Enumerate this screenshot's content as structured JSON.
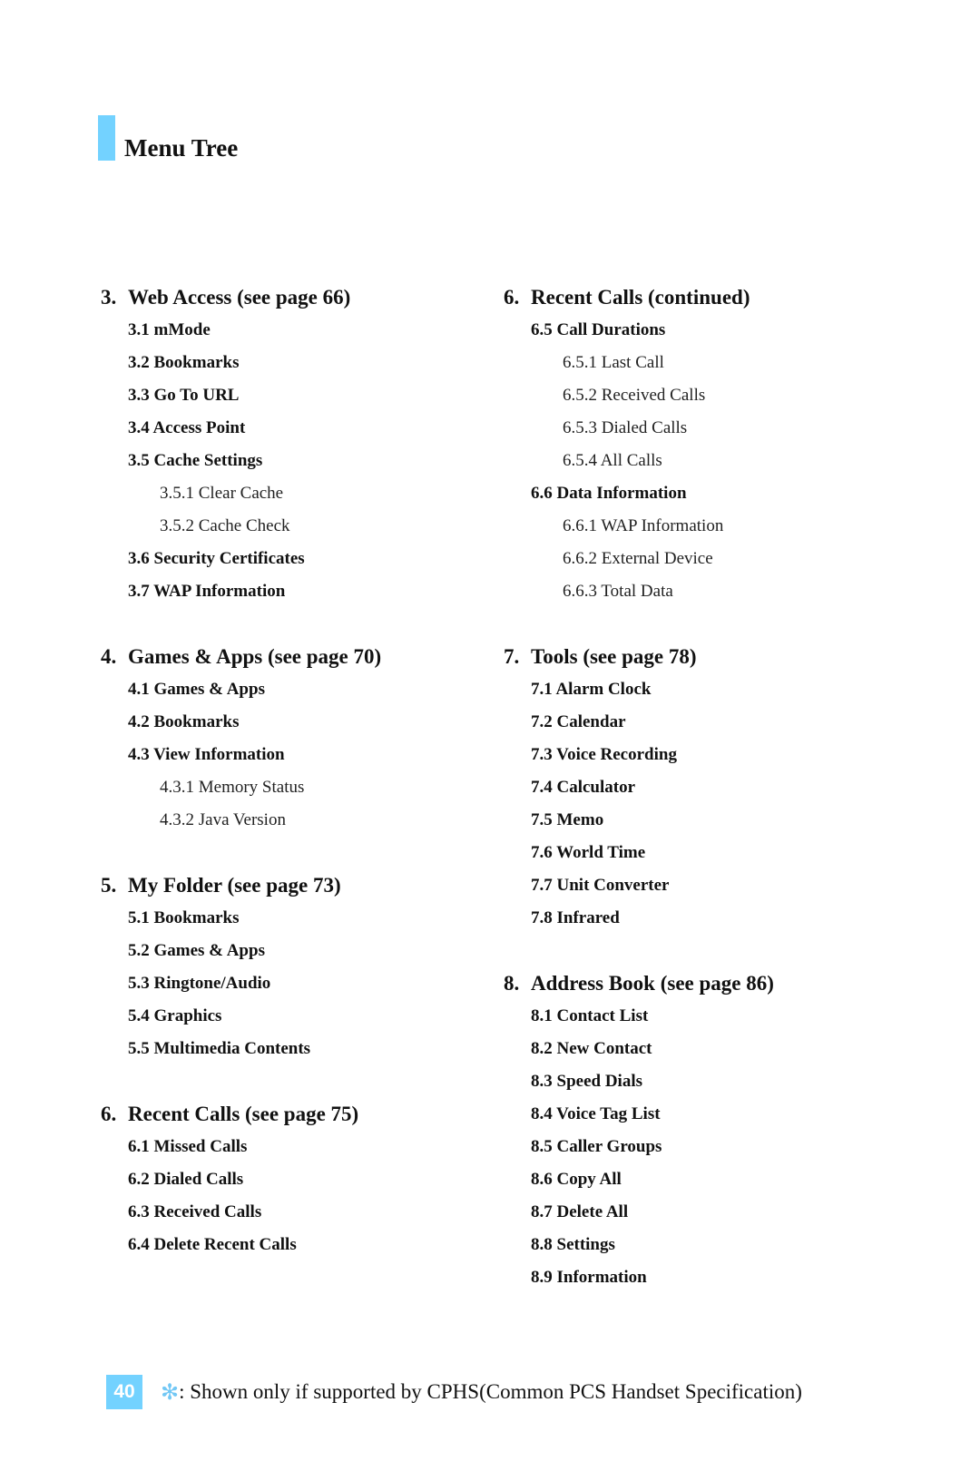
{
  "page_title": "Menu Tree",
  "accent_color": "#73d2ff",
  "columns": [
    {
      "sections": [
        {
          "number": "3.",
          "title": "Web Access (see page 66)",
          "items": [
            {
              "level": 1,
              "label": "3.1 mMode"
            },
            {
              "level": 1,
              "label": "3.2 Bookmarks"
            },
            {
              "level": 1,
              "label": "3.3 Go To URL"
            },
            {
              "level": 1,
              "label": "3.4 Access Point"
            },
            {
              "level": 1,
              "label": "3.5 Cache Settings"
            },
            {
              "level": 2,
              "label": "3.5.1 Clear Cache"
            },
            {
              "level": 2,
              "label": "3.5.2 Cache Check"
            },
            {
              "level": 1,
              "label": "3.6 Security Certificates"
            },
            {
              "level": 1,
              "label": "3.7 WAP Information"
            }
          ]
        },
        {
          "number": "4.",
          "title": "Games & Apps (see page 70)",
          "items": [
            {
              "level": 1,
              "label": "4.1 Games & Apps"
            },
            {
              "level": 1,
              "label": "4.2 Bookmarks"
            },
            {
              "level": 1,
              "label": "4.3 View Information"
            },
            {
              "level": 2,
              "label": "4.3.1 Memory Status"
            },
            {
              "level": 2,
              "label": "4.3.2 Java Version"
            }
          ]
        },
        {
          "number": "5.",
          "title": "My Folder (see page 73)",
          "items": [
            {
              "level": 1,
              "label": "5.1 Bookmarks"
            },
            {
              "level": 1,
              "label": "5.2 Games & Apps"
            },
            {
              "level": 1,
              "label": "5.3 Ringtone/Audio"
            },
            {
              "level": 1,
              "label": "5.4 Graphics"
            },
            {
              "level": 1,
              "label": "5.5 Multimedia Contents"
            }
          ]
        },
        {
          "number": "6.",
          "title": "Recent Calls (see page 75)",
          "items": [
            {
              "level": 1,
              "label": "6.1 Missed Calls"
            },
            {
              "level": 1,
              "label": "6.2 Dialed Calls"
            },
            {
              "level": 1,
              "label": "6.3 Received Calls"
            },
            {
              "level": 1,
              "label": "6.4 Delete Recent Calls"
            }
          ]
        }
      ]
    },
    {
      "sections": [
        {
          "number": "6.",
          "title": "Recent Calls (continued)",
          "items": [
            {
              "level": 1,
              "label": "6.5 Call Durations"
            },
            {
              "level": 2,
              "label": "6.5.1 Last Call"
            },
            {
              "level": 2,
              "label": "6.5.2 Received Calls"
            },
            {
              "level": 2,
              "label": "6.5.3 Dialed Calls"
            },
            {
              "level": 2,
              "label": "6.5.4 All Calls"
            },
            {
              "level": 1,
              "label": "6.6 Data Information"
            },
            {
              "level": 2,
              "label": "6.6.1 WAP Information"
            },
            {
              "level": 2,
              "label": "6.6.2 External Device"
            },
            {
              "level": 2,
              "label": "6.6.3 Total Data"
            }
          ]
        },
        {
          "number": "7.",
          "title": "Tools (see page 78)",
          "items": [
            {
              "level": 1,
              "label": "7.1 Alarm Clock"
            },
            {
              "level": 1,
              "label": "7.2 Calendar"
            },
            {
              "level": 1,
              "label": "7.3 Voice Recording"
            },
            {
              "level": 1,
              "label": "7.4 Calculator"
            },
            {
              "level": 1,
              "label": "7.5 Memo"
            },
            {
              "level": 1,
              "label": "7.6 World Time"
            },
            {
              "level": 1,
              "label": "7.7 Unit Converter"
            },
            {
              "level": 1,
              "label": "7.8 Infrared"
            }
          ]
        },
        {
          "number": "8.",
          "title": "Address Book (see page 86)",
          "items": [
            {
              "level": 1,
              "label": "8.1 Contact List"
            },
            {
              "level": 1,
              "label": "8.2 New Contact"
            },
            {
              "level": 1,
              "label": "8.3 Speed Dials"
            },
            {
              "level": 1,
              "label": "8.4 Voice Tag List"
            },
            {
              "level": 1,
              "label": "8.5 Caller Groups"
            },
            {
              "level": 1,
              "label": "8.6 Copy All"
            },
            {
              "level": 1,
              "label": "8.7 Delete All"
            },
            {
              "level": 1,
              "label": "8.8 Settings"
            },
            {
              "level": 1,
              "label": "8.9 Information"
            }
          ]
        }
      ]
    }
  ],
  "footer": {
    "page_number": "40",
    "footnote_symbol": "✻",
    "footnote_text": ": Shown only if supported by CPHS(Common PCS Handset Specification)"
  }
}
